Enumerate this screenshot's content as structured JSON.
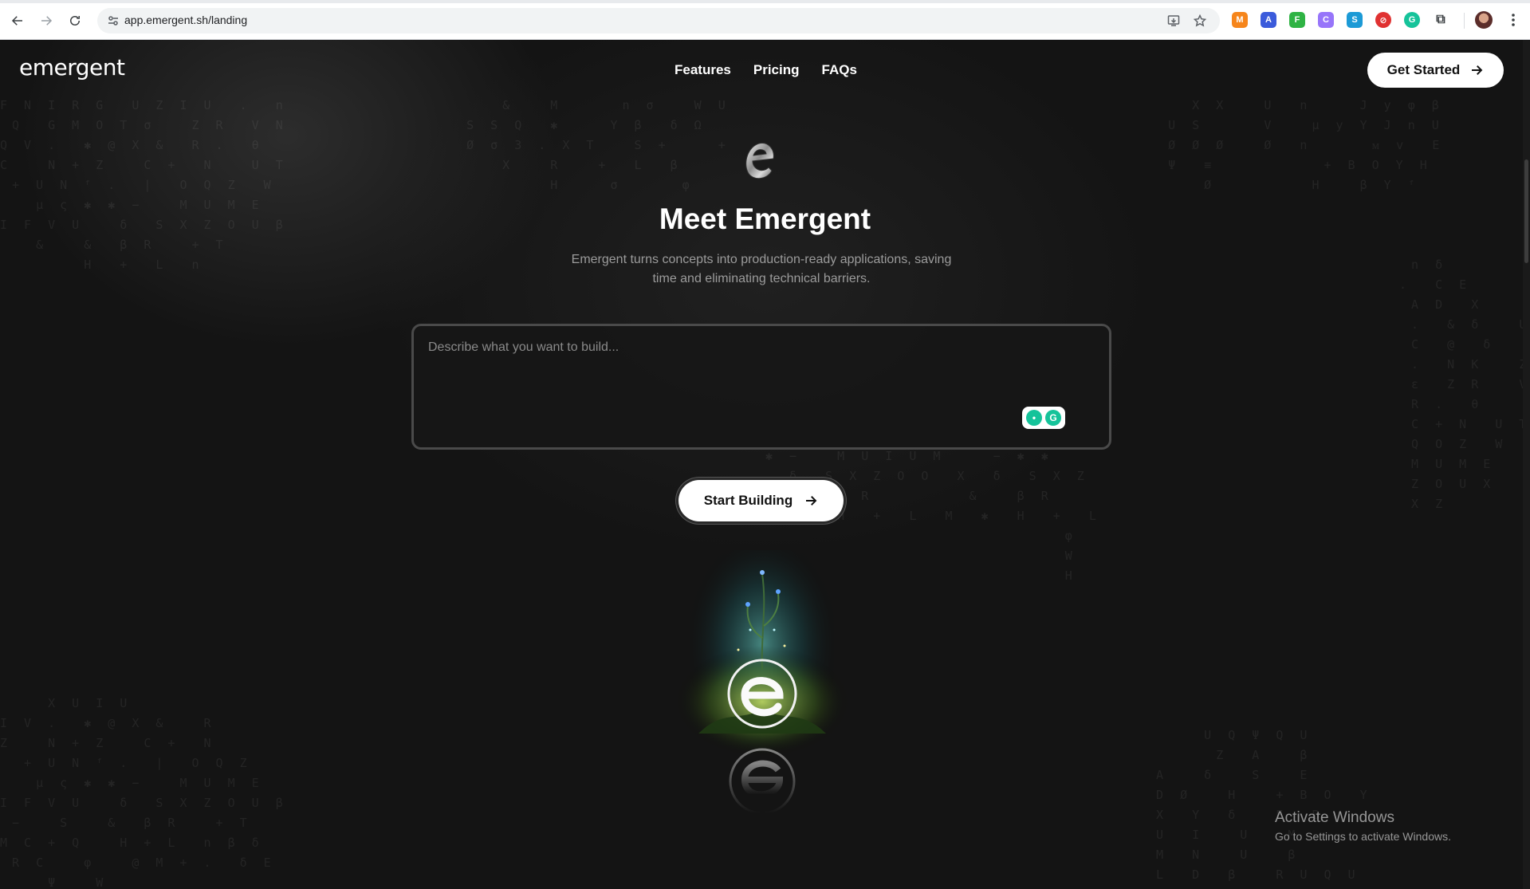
{
  "browser": {
    "url": "app.emergent.sh/landing"
  },
  "site": {
    "brand": "emergent",
    "nav": [
      {
        "label": "Features"
      },
      {
        "label": "Pricing"
      },
      {
        "label": "FAQs"
      }
    ],
    "get_started_label": "Get Started"
  },
  "hero": {
    "title": "Meet Emergent",
    "subtitle_line1": "Emergent turns concepts into production-ready applications, saving",
    "subtitle_line2": "time and eliminating technical barriers.",
    "prompt_placeholder": "Describe what you want to build...",
    "start_button_label": "Start Building"
  },
  "os_notice": {
    "title": "Activate Windows",
    "subtitle": "Go to Settings to activate Windows."
  },
  "colors": {
    "page_background": "#141414",
    "button_background": "#ffffff",
    "button_text": "#111111",
    "muted_text": "#9b9b9b",
    "grammarly_green": "#15c39a"
  }
}
